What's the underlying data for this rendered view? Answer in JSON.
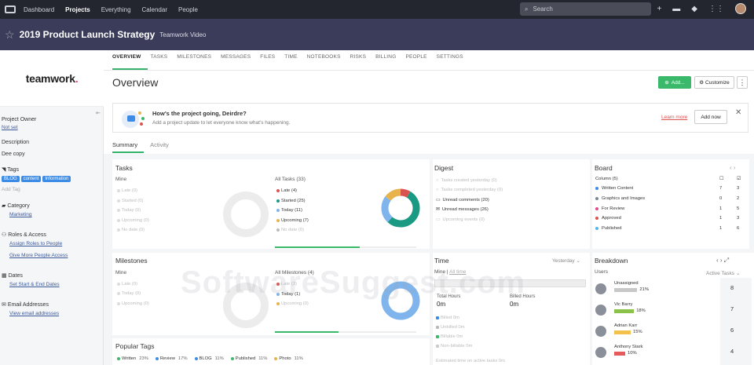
{
  "topnav": {
    "items": [
      "Dashboard",
      "Projects",
      "Everything",
      "Calendar",
      "People"
    ],
    "active": "Projects",
    "search_placeholder": "Search"
  },
  "header": {
    "title": "2019 Product Launch Strategy",
    "subtitle": "Teamwork Video"
  },
  "sidebar": {
    "brand": "teamwork",
    "brand_dot": ".",
    "project_owner_label": "Project Owner",
    "project_owner_value": "Not set",
    "description_label": "Description",
    "description_value": "Dee copy",
    "tags_label": "Tags",
    "tags": [
      "BLOG",
      "content",
      "Information"
    ],
    "add_tag": "Add Tag",
    "category_label": "Category",
    "category_value": "Marketing",
    "roles_label": "Roles & Access",
    "roles_link1": "Assign Roles to People",
    "roles_link2": "Give More People Access",
    "dates_label": "Dates",
    "dates_link": "Set Start & End Dates",
    "email_label": "Email Addresses",
    "email_link": "View email addresses"
  },
  "tabs": [
    "OVERVIEW",
    "TASKS",
    "MILESTONES",
    "MESSAGES",
    "FILES",
    "TIME",
    "NOTEBOOKS",
    "RISKS",
    "BILLING",
    "PEOPLE",
    "SETTINGS"
  ],
  "overview": {
    "title": "Overview",
    "add_label": "Add...",
    "customize_label": "Customize"
  },
  "banner": {
    "question": "How's the project going, Deirdre?",
    "desc": "Add a project update to let everyone know what's happening.",
    "learn_more": "Learn more",
    "add_now": "Add now"
  },
  "subtabs": [
    "Summary",
    "Activity"
  ],
  "tasks": {
    "title": "Tasks",
    "mine_label": "Mine",
    "mine_items": [
      "Late (0)",
      "Started (0)",
      "Today (0)",
      "Upcoming (0)",
      "No date (0)"
    ],
    "all_label": "All Tasks (33)",
    "all_items": [
      {
        "label": "Late (4)",
        "color": "#d9534f",
        "active": true
      },
      {
        "label": "Started (25)",
        "color": "#1a9a83",
        "active": true
      },
      {
        "label": "Today (11)",
        "color": "#7fb5ec",
        "active": true
      },
      {
        "label": "Upcoming (7)",
        "color": "#e8b34b",
        "active": true
      },
      {
        "label": "No date (0)",
        "color": "#bbbbbb",
        "active": false
      }
    ],
    "donut": [
      {
        "value": 4,
        "color": "#d9534f"
      },
      {
        "value": 25,
        "color": "#1a9a83"
      },
      {
        "value": 11,
        "color": "#7fb5ec"
      },
      {
        "value": 7,
        "color": "#e8b34b"
      }
    ],
    "progress": 0.6
  },
  "digest": {
    "title": "Digest",
    "items": [
      {
        "label": "Tasks created yesterday (0)",
        "active": false
      },
      {
        "label": "Tasks completed yesterday (0)",
        "active": false
      },
      {
        "label": "Unread comments (20)",
        "active": true
      },
      {
        "label": "Unread messages (26)",
        "active": true
      },
      {
        "label": "Upcoming events (0)",
        "active": false
      }
    ]
  },
  "board": {
    "title": "Board",
    "column_label": "Column (5)",
    "rows": [
      {
        "label": "Written Content",
        "color": "#3c8ce7",
        "n1": "7",
        "n2": "3"
      },
      {
        "label": "Graphics and Images",
        "color": "#7a8899",
        "n1": "0",
        "n2": "2"
      },
      {
        "label": "For Review",
        "color": "#e04a8a",
        "n1": "1",
        "n2": "5"
      },
      {
        "label": "Approved",
        "color": "#d9534f",
        "n1": "1",
        "n2": "3"
      },
      {
        "label": "Published",
        "color": "#4fb8e8",
        "n1": "1",
        "n2": "6"
      }
    ]
  },
  "milestones": {
    "title": "Milestones",
    "mine_label": "Mine",
    "mine_items": [
      "Late (0)",
      "Today (0)",
      "Upcoming (0)"
    ],
    "all_label": "All Milestones (4)",
    "all_items": [
      {
        "label": "Late (3)",
        "color": "#d9534f",
        "active": false
      },
      {
        "label": "Today (1)",
        "color": "#7fb5ec",
        "active": true
      },
      {
        "label": "Upcoming (0)",
        "color": "#e8b34b",
        "active": false
      }
    ],
    "progress": 0.45
  },
  "time": {
    "title": "Time",
    "period": "Yesterday",
    "mine": "Mine",
    "all_time": "All time",
    "total_hours_label": "Total Hours",
    "total_hours_value": "0m",
    "billed_hours_label": "Billed Hours",
    "billed_hours_value": "0m",
    "items": [
      "Billed 0m",
      "Unbilled 0m",
      "Billable 0m",
      "Non-billable 0m"
    ],
    "estimated": "Estimated time on active tasks 0m"
  },
  "breakdown": {
    "title": "Breakdown",
    "users_label": "Users",
    "active_tasks_label": "Active Tasks",
    "users": [
      {
        "name": "Unassigned",
        "pct": "21%",
        "pct_value": 21,
        "color": "#c8c8c8",
        "count": "8"
      },
      {
        "name": "Vic Barry",
        "pct": "18%",
        "pct_value": 18,
        "color": "#8bc34a",
        "count": "7"
      },
      {
        "name": "Adrian Karr",
        "pct": "15%",
        "pct_value": 15,
        "color": "#f3c24d",
        "count": "6"
      },
      {
        "name": "Anthony Stark",
        "pct": "10%",
        "pct_value": 10,
        "color": "#e55b5b",
        "count": "4"
      }
    ]
  },
  "popular_tags": {
    "title": "Popular Tags",
    "items": [
      {
        "label": "Written",
        "pct": "23%",
        "color": "#3bb96b"
      },
      {
        "label": "Review",
        "pct": "17%",
        "color": "#3c8ce7"
      },
      {
        "label": "BLOG",
        "pct": "11%",
        "color": "#3c8ce7"
      },
      {
        "label": "Published",
        "pct": "11%",
        "color": "#3bb96b"
      },
      {
        "label": "Photo",
        "pct": "11%",
        "color": "#e8b34b"
      }
    ]
  },
  "watermark": "SoftwareSuggest.com"
}
